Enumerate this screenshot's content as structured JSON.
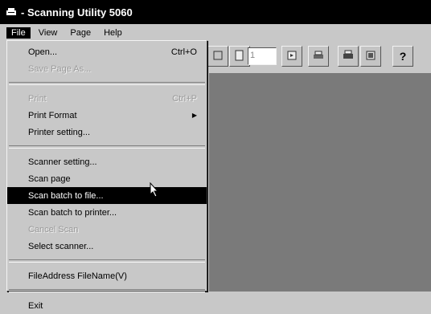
{
  "window": {
    "title": "- Scanning Utility 5060",
    "app_icon": "scanner-icon"
  },
  "menubar": {
    "items": [
      "File",
      "View",
      "Page",
      "Help"
    ],
    "active": "File"
  },
  "toolbar": {
    "page_field_value": "1"
  },
  "file_menu": {
    "open_label": "Open...",
    "open_shortcut": "Ctrl+O",
    "save_page_as_label": "Save Page As...",
    "print_label": "Print",
    "print_shortcut": "Ctrl+P",
    "print_format_label": "Print Format",
    "printer_setting_label": "Printer setting...",
    "scanner_setting_label": "Scanner setting...",
    "scan_page_label": "Scan page",
    "scan_batch_file_label": "Scan batch to file...",
    "scan_batch_printer_label": "Scan batch to printer...",
    "cancel_scan_label": "Cancel Scan",
    "select_scanner_label": "Select scanner...",
    "file_address_label": "FileAddress FileName(V)",
    "exit_label": "Exit"
  }
}
